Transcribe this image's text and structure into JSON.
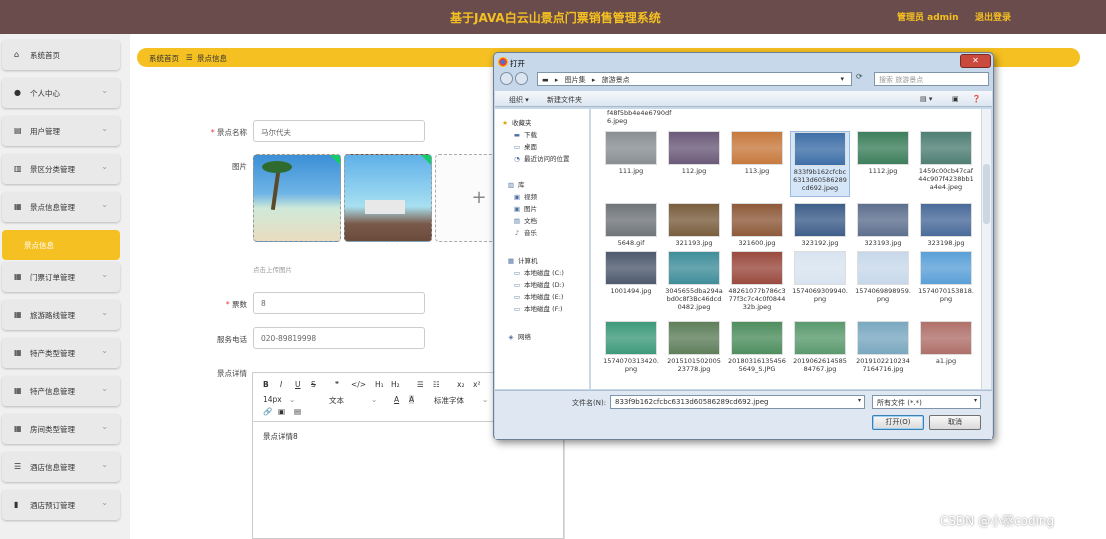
{
  "header": {
    "title": "基于JAVA白云山景点门票销售管理系统",
    "admin": "管理员 admin",
    "logout": "退出登录"
  },
  "sidebar": {
    "items": [
      {
        "label": "系统首页",
        "icon": "home-icon",
        "glyph": "⌂",
        "chevron": false
      },
      {
        "label": "个人中心",
        "icon": "user-icon",
        "glyph": "●",
        "chevron": true
      },
      {
        "label": "用户管理",
        "icon": "table-icon",
        "glyph": "▤",
        "chevron": true
      },
      {
        "label": "景区分类管理",
        "icon": "bar-chart-icon",
        "glyph": "▥",
        "chevron": true
      },
      {
        "label": "景点信息管理",
        "icon": "grid-icon",
        "glyph": "▦",
        "chevron": true
      },
      {
        "label": "景点信息",
        "icon": "",
        "glyph": "",
        "chevron": false,
        "active": true
      },
      {
        "label": "门票订单管理",
        "icon": "grid-icon",
        "glyph": "▦",
        "chevron": true
      },
      {
        "label": "旅游路线管理",
        "icon": "grid-icon",
        "glyph": "▦",
        "chevron": true
      },
      {
        "label": "特产类型管理",
        "icon": "grid-icon",
        "glyph": "▦",
        "chevron": true
      },
      {
        "label": "特产信息管理",
        "icon": "grid-icon",
        "glyph": "▦",
        "chevron": true
      },
      {
        "label": "房间类型管理",
        "icon": "grid-icon",
        "glyph": "▦",
        "chevron": true
      },
      {
        "label": "酒店信息管理",
        "icon": "sliders-icon",
        "glyph": "☰",
        "chevron": true
      },
      {
        "label": "酒店预订管理",
        "icon": "chart-icon",
        "glyph": "▮",
        "chevron": true
      }
    ]
  },
  "breadcrumb": {
    "home": "系统首页",
    "sep": "☰",
    "current": "景点信息"
  },
  "form": {
    "name_label": "景点名称",
    "name_value": "马尔代夫",
    "image_label": "图片",
    "upload_tip": "点击上传图片",
    "ticket_label": "票数",
    "ticket_value": "8",
    "phone_label": "服务电话",
    "phone_value": "020-89819998",
    "detail_label": "景点详情",
    "required_mark": "*"
  },
  "editor": {
    "toolbar_row1": [
      "B",
      "I",
      "U",
      "S",
      "❞",
      "</>",
      "H₁",
      "H₂",
      "☰",
      "☷",
      "x₂",
      "x²"
    ],
    "font_size": "14px",
    "text_style": "文本",
    "font_family": "标准字体",
    "content": "景点详情8"
  },
  "dialog": {
    "title": "打开",
    "close": "✕",
    "path": [
      "图片集",
      "旅游景点"
    ],
    "search_placeholder": "搜索 旅游景点",
    "toolbar": {
      "organize": "组织 ▾",
      "new_folder": "新建文件夹"
    },
    "nav": [
      {
        "label": "收藏夹",
        "icon": "star-icon",
        "glyph": "★"
      },
      {
        "label": "下载",
        "icon": "folder-icon",
        "glyph": "▬"
      },
      {
        "label": "桌面",
        "icon": "desktop-icon",
        "glyph": "▭"
      },
      {
        "label": "最近访问的位置",
        "icon": "clock-icon",
        "glyph": "◔"
      },
      {
        "label": "库",
        "icon": "library-icon",
        "glyph": "▥"
      },
      {
        "label": "视频",
        "icon": "video-icon",
        "glyph": "▣"
      },
      {
        "label": "图片",
        "icon": "picture-icon",
        "glyph": "▣"
      },
      {
        "label": "文档",
        "icon": "document-icon",
        "glyph": "▤"
      },
      {
        "label": "音乐",
        "icon": "music-icon",
        "glyph": "♪"
      },
      {
        "label": "计算机",
        "icon": "computer-icon",
        "glyph": "▦"
      },
      {
        "label": "本地磁盘 (C:)",
        "icon": "drive-icon",
        "glyph": "▭"
      },
      {
        "label": "本地磁盘 (D:)",
        "icon": "drive-icon",
        "glyph": "▭"
      },
      {
        "label": "本地磁盘 (E:)",
        "icon": "drive-icon",
        "glyph": "▭"
      },
      {
        "label": "本地磁盘 (F:)",
        "icon": "drive-icon",
        "glyph": "▭"
      },
      {
        "label": "网络",
        "icon": "network-icon",
        "glyph": "◈"
      }
    ],
    "top_partial": "f48f5bb4e4e6790df6.jpeg",
    "files": [
      {
        "name": "111.jpg",
        "color": "#8a8f94"
      },
      {
        "name": "112.jpg",
        "color": "#6c5a7a"
      },
      {
        "name": "113.jpg",
        "color": "#c77a3e"
      },
      {
        "name": "833f9b162cfcbc6313d60586289cd692.jpeg",
        "color": "#3e6fa8",
        "selected": true
      },
      {
        "name": "1112.jpg",
        "color": "#3d7f5c"
      },
      {
        "name": "1459c00cb47caf44c907f4238bb1a4e4.jpeg",
        "color": "#4f7f74"
      },
      {
        "name": "5648.gif",
        "color": "#70757a"
      },
      {
        "name": "321193.jpg",
        "color": "#7a5e3e"
      },
      {
        "name": "321600.jpg",
        "color": "#8e5a3a"
      },
      {
        "name": "323192.jpg",
        "color": "#3e5e8a"
      },
      {
        "name": "323193.jpg",
        "color": "#5e6f8e"
      },
      {
        "name": "323198.jpg",
        "color": "#4a6b9a"
      },
      {
        "name": "1001494.jpg",
        "color": "#4e5a6e"
      },
      {
        "name": "3045655dba294abd0c8f3Bc46dcd0482.jpeg",
        "color": "#3f8e9a"
      },
      {
        "name": "48261077b786c377f3c7c4c0f084432b.jpeg",
        "color": "#9a4a3e"
      },
      {
        "name": "1574069309940.png",
        "color": "#d8e4f0"
      },
      {
        "name": "1574069898959.png",
        "color": "#c7d8ea"
      },
      {
        "name": "1574070153818.png",
        "color": "#5aa0d8"
      },
      {
        "name": "1574070313420.png",
        "color": "#3e9a7a"
      },
      {
        "name": "2015101502005 23778.jpg",
        "color": "#5e7f5a"
      },
      {
        "name": "20180316135456 5649_S.JPG",
        "color": "#4e8e5e"
      },
      {
        "name": "2019062614585 84767.jpg",
        "color": "#5a9a6e"
      },
      {
        "name": "2019102210234 7164716.jpg",
        "color": "#7aa8c0"
      },
      {
        "name": "a1.jpg",
        "color": "#b0706a"
      }
    ],
    "filename_label": "文件名(N):",
    "filename_value": "833f9b162cfcbc6313d60586289cd692.jpeg",
    "filetype": "所有文件 (*.*)",
    "open": "打开(O)",
    "cancel": "取消"
  },
  "watermark": "CSDN @小蔡coding",
  "colors": {
    "accent": "#f5c021",
    "header_bg": "#6b4c4c",
    "required": "#e33"
  }
}
